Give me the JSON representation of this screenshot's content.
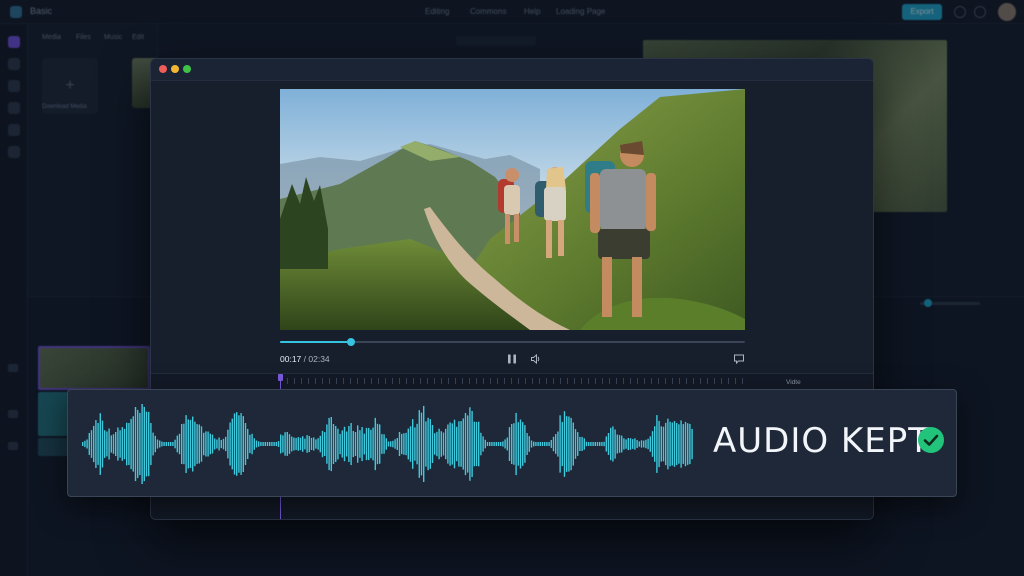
{
  "background_app": {
    "name": "Basic",
    "nav": [
      "Editing",
      "Commons",
      "Help",
      "Loading Page"
    ],
    "export_label": "Export",
    "media_tabs": [
      "Media",
      "Files",
      "Music",
      "Edit"
    ],
    "import_label": "Download Media"
  },
  "player": {
    "current_time": "00:17",
    "duration": "02:34",
    "progress_fraction": 0.153,
    "timeline_label": "Vidte",
    "icons": {
      "pause": "pause-icon",
      "volume": "volume-icon",
      "subtitles": "subtitles-icon"
    }
  },
  "audio_card": {
    "label": "AUDIO KEPT",
    "check_icon": "check-circle-icon",
    "wave_color": "#3ec9dc",
    "check_color": "#22c37a"
  },
  "colors": {
    "accent": "#35c3e0",
    "playhead": "#7b5be0"
  }
}
